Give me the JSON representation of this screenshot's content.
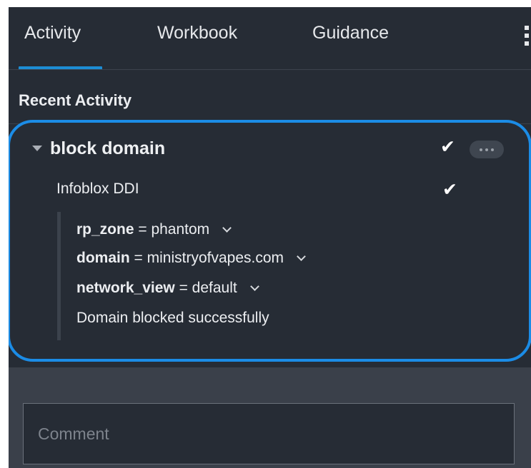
{
  "tabs": [
    {
      "label": "Activity",
      "active": true
    },
    {
      "label": "Workbook",
      "active": false
    },
    {
      "label": "Guidance",
      "active": false
    }
  ],
  "recent_activity": {
    "title": "Recent Activity",
    "action": {
      "name": "block domain",
      "status": "success",
      "app": {
        "name": "Infoblox DDI",
        "status": "success",
        "parameters": [
          {
            "key": "rp_zone",
            "value": "phantom"
          },
          {
            "key": "domain",
            "value": "ministryofvapes.com"
          },
          {
            "key": "network_view",
            "value": "default"
          }
        ],
        "result_message": "Domain blocked successfully"
      }
    }
  },
  "comment": {
    "placeholder": "Comment",
    "value": ""
  },
  "colors": {
    "panel_bg": "#262c35",
    "accent": "#1d8dd4",
    "highlight_ring": "#1b8ce6",
    "comment_area_bg": "#3a404a"
  },
  "icons": [
    "caret-down-icon",
    "checkmark-icon",
    "more-options-icon",
    "kebab-menu-icon",
    "chevron-down-icon"
  ]
}
